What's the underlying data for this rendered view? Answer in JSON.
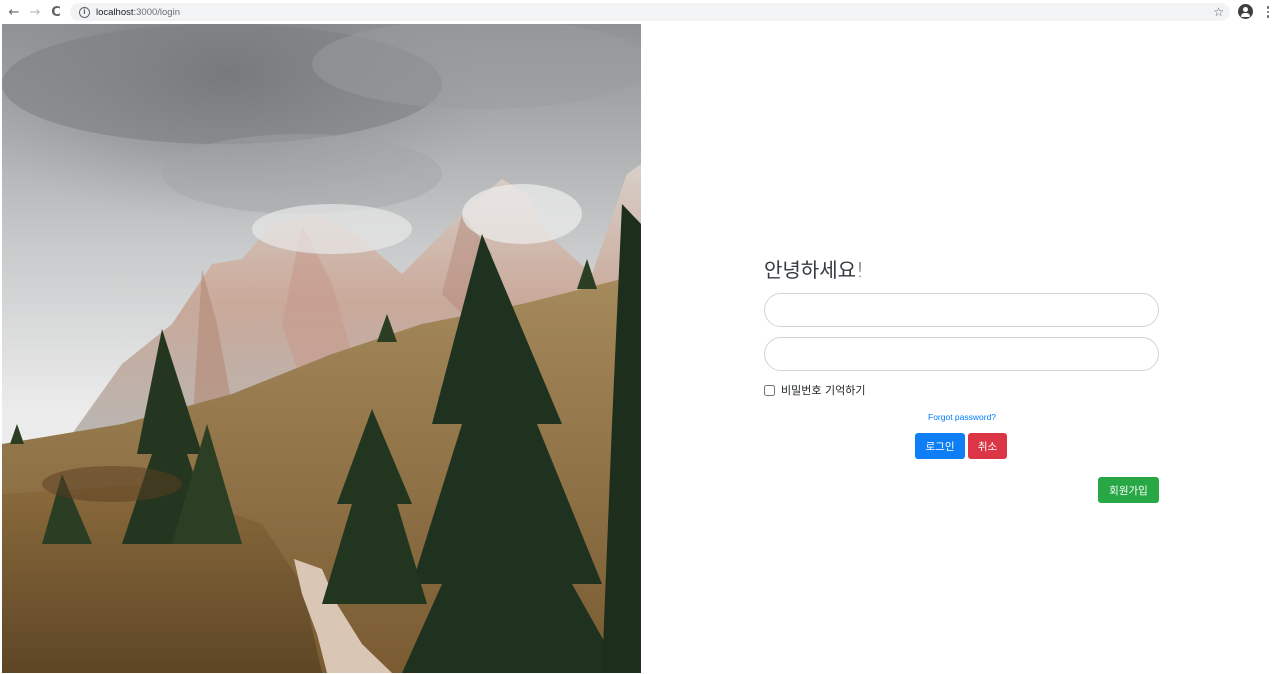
{
  "browser": {
    "back_icon": "←",
    "forward_icon": "→",
    "reload_icon": "C",
    "info_icon": "i",
    "url_host": "localhost",
    "url_path": ":3000/login",
    "star_icon": "☆"
  },
  "photo": {
    "subject": "mountain-landscape-photo"
  },
  "login": {
    "greeting": "안녕하세요!",
    "username_value": "",
    "password_value": "",
    "remember_label": "비밀번호 기억하기",
    "remember_checked": false,
    "forgot_link": "Forgot password?",
    "login_button": "로그인",
    "cancel_button": "취소",
    "signup_button": "회원가입"
  },
  "colors": {
    "primary": "#0d7ef3",
    "danger": "#dc3545",
    "success": "#28a745",
    "link": "#007bff"
  }
}
